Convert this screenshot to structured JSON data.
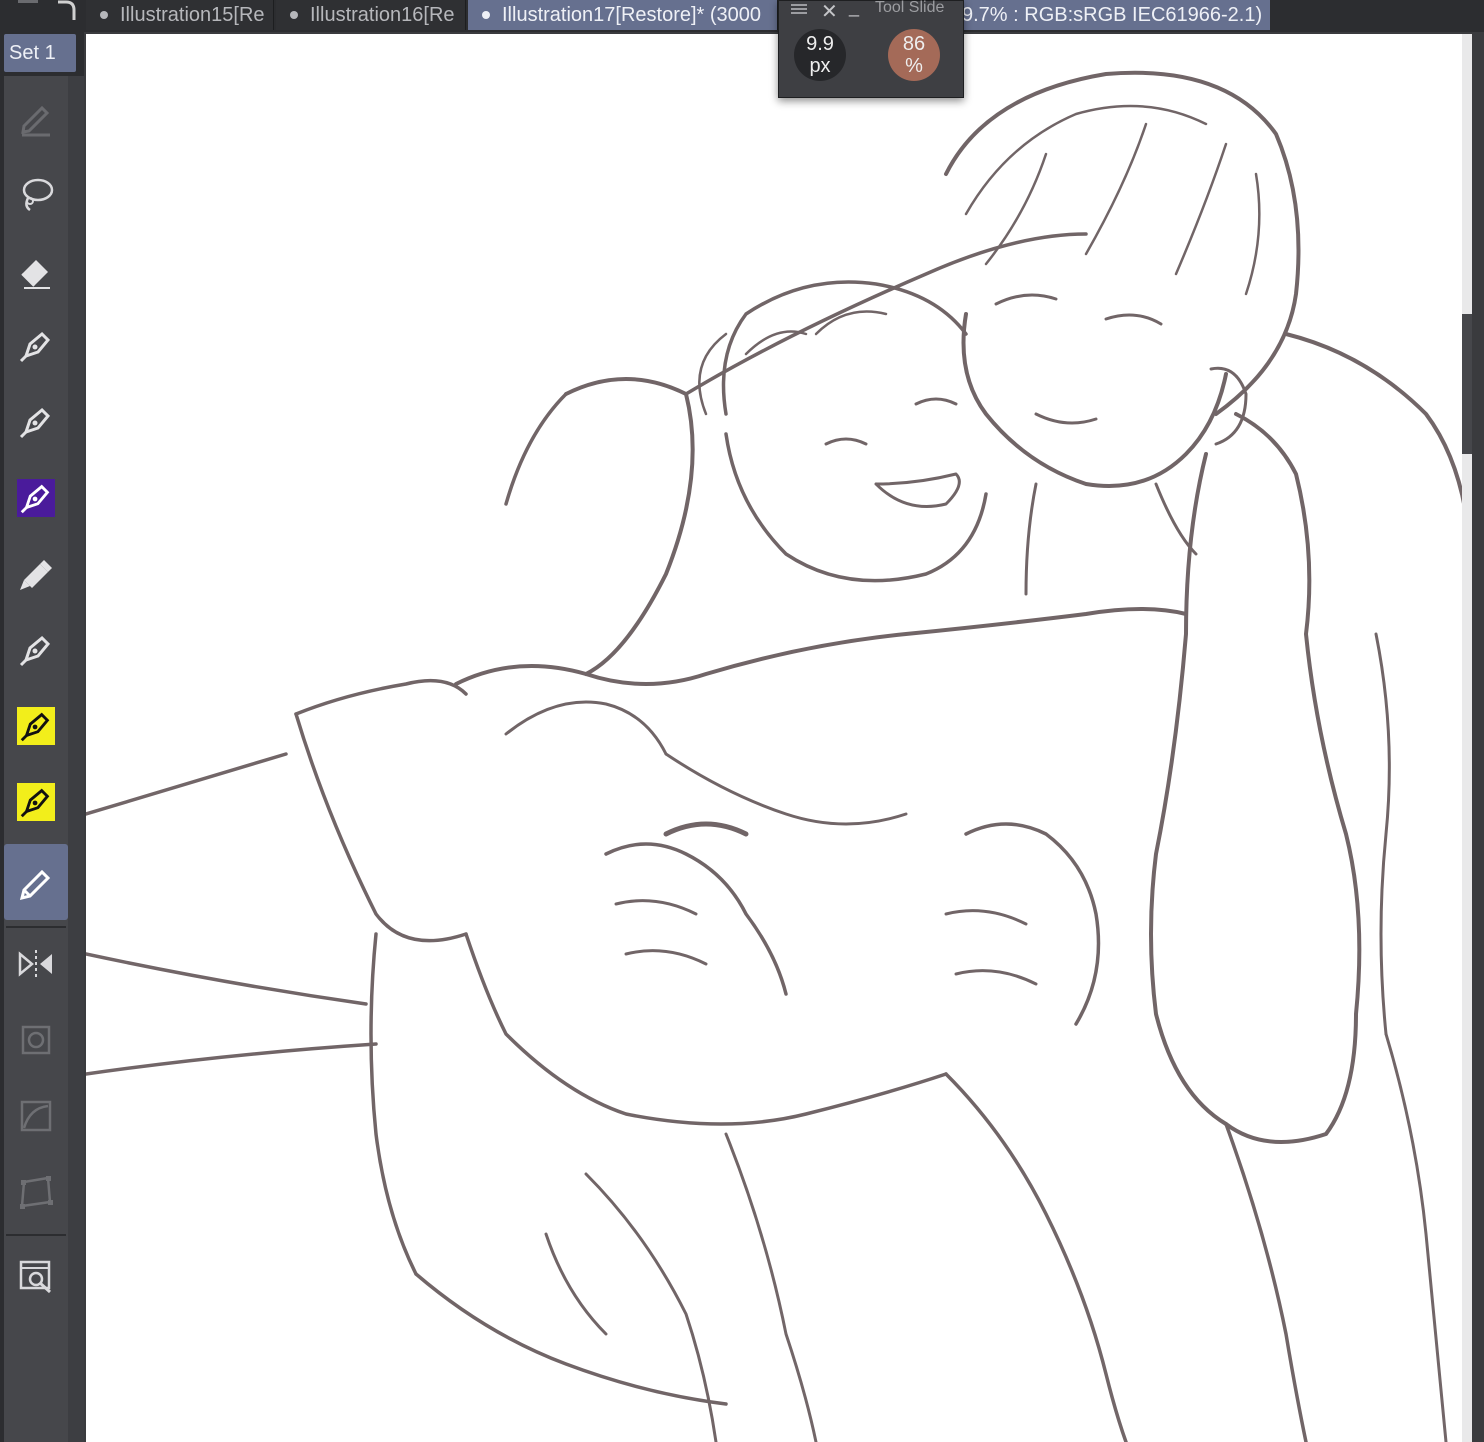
{
  "tabs": [
    {
      "label": "Illustration15[Re",
      "active": false
    },
    {
      "label": "Illustration16[Re",
      "active": false
    },
    {
      "label": "Illustration17[Restore]* (3000",
      "active": true
    }
  ],
  "status_text": "9.7% : RGB:sRGB IEC61966-2.1)",
  "tool_set": {
    "label": "Set 1"
  },
  "tools": [
    {
      "name": "pencil-tool",
      "icon": "pencil-icon",
      "color": ""
    },
    {
      "name": "lasso-tool",
      "icon": "lasso-icon",
      "color": ""
    },
    {
      "name": "eraser-tool",
      "icon": "eraser-icon",
      "color": ""
    },
    {
      "name": "pen-tool-1",
      "icon": "pen-nib-icon",
      "color": ""
    },
    {
      "name": "pen-tool-2",
      "icon": "pen-nib-icon",
      "color": ""
    },
    {
      "name": "pen-tool-purple",
      "icon": "pen-nib-icon",
      "color": "#4a1b9b"
    },
    {
      "name": "marker-tool",
      "icon": "marker-icon",
      "color": ""
    },
    {
      "name": "pen-tool-3",
      "icon": "pen-nib-icon",
      "color": ""
    },
    {
      "name": "pen-tool-yellow-1",
      "icon": "pen-nib-icon",
      "color": "#f2ee1b"
    },
    {
      "name": "pen-tool-yellow-2",
      "icon": "pen-nib-icon",
      "color": "#f2ee1b"
    },
    {
      "name": "pen-tool-selected",
      "icon": "pen-nib-icon",
      "color": ""
    },
    {
      "name": "mirror-tool",
      "icon": "mirror-icon",
      "color": ""
    },
    {
      "name": "transform-tool",
      "icon": "transform-icon",
      "color": ""
    },
    {
      "name": "curve-tool",
      "icon": "curve-icon",
      "color": ""
    },
    {
      "name": "free-transform-tool",
      "icon": "free-transform-icon",
      "color": ""
    },
    {
      "name": "navigator-tool",
      "icon": "navigator-icon",
      "color": ""
    }
  ],
  "tool_slider": {
    "title": "Tool Slide",
    "size_value": "9.9",
    "size_unit": "px",
    "opacity_value": "86",
    "opacity_unit": "%"
  },
  "colors": {
    "accent": "#66708f",
    "opacity_knob": "#a46a58",
    "sketch_stroke": "#4a3b3d"
  }
}
